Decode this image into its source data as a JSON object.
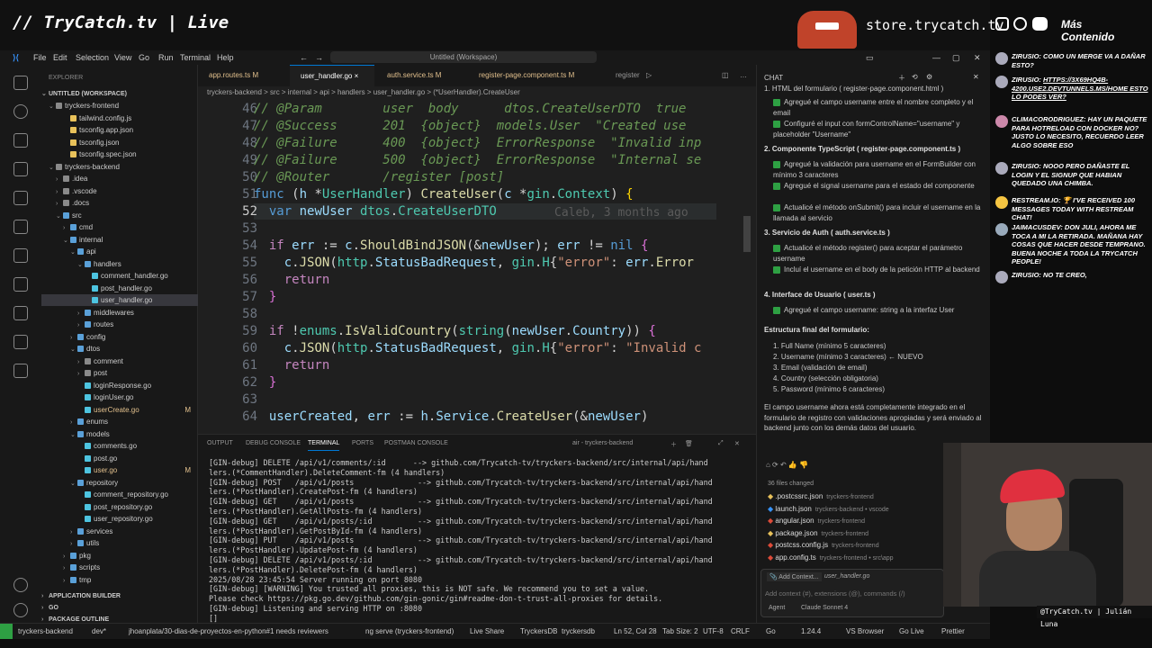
{
  "stream": {
    "brand": "// TryCatch.tv | Live",
    "store": "store.trycatch.tv",
    "mas": "Más Contenido",
    "cam_name": "@TryCatch.tv | Julián Luna"
  },
  "menu": [
    "File",
    "Edit",
    "Selection",
    "View",
    "Go",
    "Run",
    "Terminal",
    "Help"
  ],
  "workspace_title": "Untitled (Workspace)",
  "explorer": {
    "header": "EXPLORER",
    "section": "UNTITLED (WORKSPACE)",
    "items": [
      {
        "label": "tryckers-frontend",
        "depth": 1
      },
      {
        "label": "tailwind.config.js",
        "depth": 3
      },
      {
        "label": "tsconfig.app.json",
        "depth": 3
      },
      {
        "label": "tsconfig.json",
        "depth": 3
      },
      {
        "label": "tsconfig.spec.json",
        "depth": 3
      },
      {
        "label": "tryckers-backend",
        "depth": 1
      },
      {
        "label": ".idea",
        "depth": 2
      },
      {
        "label": ".vscode",
        "depth": 2
      },
      {
        "label": ".docs",
        "depth": 2
      },
      {
        "label": "src",
        "depth": 2
      },
      {
        "label": "cmd",
        "depth": 3
      },
      {
        "label": "internal",
        "depth": 3
      },
      {
        "label": "api",
        "depth": 4
      },
      {
        "label": "handlers",
        "depth": 5
      },
      {
        "label": "comment_handler.go",
        "depth": 6
      },
      {
        "label": "post_handler.go",
        "depth": 6
      },
      {
        "label": "user_handler.go",
        "depth": 6
      },
      {
        "label": "middlewares",
        "depth": 5
      },
      {
        "label": "routes",
        "depth": 5
      },
      {
        "label": "config",
        "depth": 4
      },
      {
        "label": "dtos",
        "depth": 4
      },
      {
        "label": "comment",
        "depth": 5
      },
      {
        "label": "post",
        "depth": 5
      },
      {
        "label": "loginResponse.go",
        "depth": 5
      },
      {
        "label": "loginUser.go",
        "depth": 5
      },
      {
        "label": "userCreate.go",
        "depth": 5,
        "badge": "M"
      },
      {
        "label": "enums",
        "depth": 4
      },
      {
        "label": "models",
        "depth": 4
      },
      {
        "label": "comments.go",
        "depth": 5
      },
      {
        "label": "post.go",
        "depth": 5
      },
      {
        "label": "user.go",
        "depth": 5,
        "badge": "M"
      },
      {
        "label": "repository",
        "depth": 4
      },
      {
        "label": "comment_repository.go",
        "depth": 5
      },
      {
        "label": "post_repository.go",
        "depth": 5
      },
      {
        "label": "user_repository.go",
        "depth": 5
      },
      {
        "label": "services",
        "depth": 4
      },
      {
        "label": "utils",
        "depth": 4
      },
      {
        "label": "pkg",
        "depth": 3
      },
      {
        "label": "scripts",
        "depth": 3
      },
      {
        "label": "tmp",
        "depth": 3
      }
    ],
    "bottom": [
      "APPLICATION BUILDER",
      "GO",
      "PACKAGE OUTLINE"
    ]
  },
  "tabs": [
    {
      "label": "app.routes.ts M"
    },
    {
      "label": "user_handler.go ×"
    },
    {
      "label": "auth.service.ts M"
    },
    {
      "label": "register-page.component.ts M"
    },
    {
      "label": "register"
    }
  ],
  "breadcrumb": "tryckers-backend > src > internal > api > handlers > user_handler.go > (*UserHandler).CreateUser",
  "code": {
    "line_numbers": [
      "46",
      "47",
      "48",
      "49",
      "50",
      "51",
      "52",
      "53",
      "54",
      "55",
      "56",
      "57",
      "58",
      "59",
      "60",
      "61",
      "62",
      "63",
      "64"
    ],
    "blame": "Caleb, 3 months ago"
  },
  "panel": {
    "tabs": [
      "OUTPUT",
      "DEBUG CONSOLE",
      "TERMINAL",
      "PORTS",
      "POSTMAN CONSOLE"
    ],
    "session": "air - tryckers-backend",
    "lines": [
      "[GIN-debug] DELETE /api/v1/comments/:id      --> github.com/Trycatch-tv/tryckers-backend/src/internal/api/hand",
      "lers.(*CommentHandler).DeleteComment-fm (4 handlers)",
      "[GIN-debug] POST   /api/v1/posts              --> github.com/Trycatch-tv/tryckers-backend/src/internal/api/hand",
      "lers.(*PostHandler).CreatePost-fm (4 handlers)",
      "[GIN-debug] GET    /api/v1/posts              --> github.com/Trycatch-tv/tryckers-backend/src/internal/api/hand",
      "lers.(*PostHandler).GetAllPosts-fm (4 handlers)",
      "[GIN-debug] GET    /api/v1/posts/:id          --> github.com/Trycatch-tv/tryckers-backend/src/internal/api/hand",
      "lers.(*PostHandler).GetPostById-fm (4 handlers)",
      "[GIN-debug] PUT    /api/v1/posts              --> github.com/Trycatch-tv/tryckers-backend/src/internal/api/hand",
      "lers.(*PostHandler).UpdatePost-fm (4 handlers)",
      "[GIN-debug] DELETE /api/v1/posts/:id          --> github.com/Trycatch-tv/tryckers-backend/src/internal/api/hand",
      "lers.(*PostHandler).DeletePost-fm (4 handlers)",
      "2025/08/28 23:45:54 Server running on port 8080",
      "[GIN-debug] [WARNING] You trusted all proxies, this is NOT safe. We recommend you to set a value.",
      "Please check https://pkg.go.dev/github.com/gin-gonic/gin#readme-don-t-trust-all-proxies for details.",
      "[GIN-debug] Listening and serving HTTP on :8080",
      "[]"
    ]
  },
  "status": {
    "branch": "tryckers-backend",
    "dev": "dev*",
    "pr": "jhoanplata/30-dias-de-proyectos-en-python#1 needs reviewers",
    "serve": "ng serve (tryckers-frontend)",
    "live": "Live Share",
    "db1": "TryckersDB",
    "db2": "tryckersdb",
    "pos": "Ln 52, Col 28",
    "tab": "Tab Size: 2",
    "enc": "UTF-8",
    "eol": "CRLF",
    "lang": "Go",
    "ver": "1.24.4",
    "vs": "VS Browser",
    "golive": "Go Live",
    "prettier": "Prettier"
  },
  "chat": {
    "title": "CHAT",
    "intro": "1. HTML del formulario ( register-page.component.html )",
    "s1": [
      "Agregué el campo username entre el nombre completo y el email",
      "Configuré el input con formControlName=\"username\" y placeholder \"Username\""
    ],
    "h2": "2. Componente TypeScript ( register-page.component.ts )",
    "s2": [
      "Agregué la validación para username en el FormBuilder con mínimo 3 caracteres",
      "Agregué el signal  username  para el estado del componente",
      "Actualicé el método  onSubmit()  para incluir el username en la llamada al servicio"
    ],
    "h3": "3. Servicio de Auth ( auth.service.ts )",
    "s3": [
      "Actualicé el método  register()  para aceptar el parámetro username",
      "Incluí el username en el body de la petición HTTP al backend"
    ],
    "h4": "4. Interface de Usuario ( user.ts )",
    "s4": [
      "Agregué el campo  username: string  a la interfaz User"
    ],
    "struct_title": "Estructura final del formulario:",
    "struct": [
      "1. Full Name (mínimo 5 caracteres)",
      "2. Username (mínimo 3 caracteres) ← NUEVO",
      "3. Email (validación de email)",
      "4. Country (selección obligatoria)",
      "5. Password (mínimo 6 caracteres)"
    ],
    "summary": "El campo username ahora está completamente integrado en el formulario de registro con validaciones apropiadas y será enviado al backend junto con los demás datos del usuario.",
    "changed": "36 files changed",
    "files": [
      {
        "name": ".postcssrc.json",
        "proj": "tryckers-frontend"
      },
      {
        "name": "launch.json",
        "proj": "tryckers-backend • vscode"
      },
      {
        "name": "angular.json",
        "proj": "tryckers-frontend"
      },
      {
        "name": "package.json",
        "proj": "tryckers-frontend"
      },
      {
        "name": "postcss.config.js",
        "proj": "tryckers-frontend"
      },
      {
        "name": "app.config.ts",
        "proj": "tryckers-frontend • src\\app"
      }
    ],
    "add_context": "Add Context...",
    "ctx_file": "user_handler.go",
    "input_placeholder": "Add context (#), extensions (@), commands (/)",
    "agent": "Agent",
    "model": "Claude Sonnet 4"
  },
  "twitch": [
    {
      "user": "ZIRUSIO:",
      "text": "COMO UN MERGE VA A DAÑAR ESTO?"
    },
    {
      "user": "ZIRUSIO:",
      "text": "HTTPS://3X69HQ4B-4200.USE2.DEVTUNNELS.MS/HOME ESTO LO PODES VER?"
    },
    {
      "user": "CLIMACORODRIGUEZ:",
      "text": "HAY UN PAQUETE PARA HOTRELOAD CON DOCKER NO? JUSTO LO NECESITO, RECUERDO LEER ALGO SOBRE ESO"
    },
    {
      "user": "ZIRUSIO:",
      "text": "NOOO PERO DAÑASTE EL LOGIN Y EL SIGNUP QUE HABIAN QUEDADO UNA CHIMBA."
    },
    {
      "user": "RESTREAM.IO:",
      "text": "🏆 I'VE RECEIVED 100 MESSAGES TODAY WITH RESTREAM CHAT!"
    },
    {
      "user": "JAIMACUSDEV:",
      "text": "DON JULI, AHORA ME TOCA A MI LA RETIRADA. MAÑANA HAY COSAS QUE HACER DESDE TEMPRANO. BUENA NOCHE A TODA LA TRYCATCH PEOPLE!"
    },
    {
      "user": "ZIRUSIO:",
      "text": "NO TE CREO,"
    }
  ]
}
